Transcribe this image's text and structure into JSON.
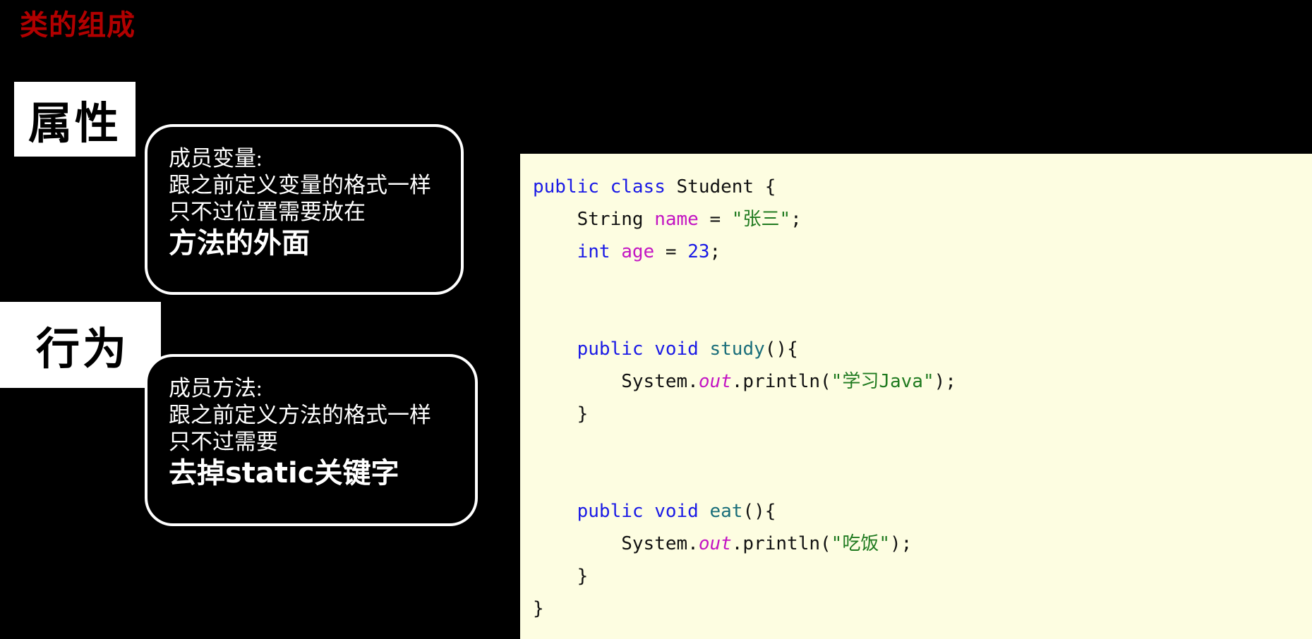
{
  "slide": {
    "title": "类的组成",
    "title_color": "#b10000",
    "background_color": "#000000"
  },
  "labels": [
    {
      "id": "attributes",
      "text": "属性"
    },
    {
      "id": "behaviour",
      "text": "行为"
    }
  ],
  "bubbles": [
    {
      "id": "member-variable",
      "lines": [
        "成员变量:",
        "跟之前定义变量的格式一样",
        "只不过位置需要放在"
      ],
      "emphasis": "方法的外面"
    },
    {
      "id": "member-method",
      "lines": [
        "成员方法:",
        "跟之前定义方法的格式一样",
        "只不过需要"
      ],
      "emphasis": "去掉static关键字"
    }
  ],
  "code_panel": {
    "background_color": "#fdfde1",
    "language": "java",
    "colors": {
      "keyword": "#1a1ae6",
      "identifier": "#c315c3",
      "string": "#1f7a1f",
      "number": "#1a1ae6",
      "method": "#1a6e7a",
      "plain": "#111111"
    },
    "lines": [
      {
        "indent": 0,
        "tokens": [
          {
            "t": "public",
            "c": "kw"
          },
          {
            "t": " ",
            "c": "plain"
          },
          {
            "t": "class",
            "c": "kw"
          },
          {
            "t": " Student {",
            "c": "plain"
          }
        ]
      },
      {
        "indent": 1,
        "tokens": [
          {
            "t": "String",
            "c": "plain"
          },
          {
            "t": " ",
            "c": "plain"
          },
          {
            "t": "name",
            "c": "ident-mag"
          },
          {
            "t": " = ",
            "c": "plain"
          },
          {
            "t": "\"张三\"",
            "c": "str-green"
          },
          {
            "t": ";",
            "c": "plain"
          }
        ]
      },
      {
        "indent": 1,
        "tokens": [
          {
            "t": "int",
            "c": "kw"
          },
          {
            "t": " ",
            "c": "plain"
          },
          {
            "t": "age",
            "c": "ident-mag"
          },
          {
            "t": " = ",
            "c": "plain"
          },
          {
            "t": "23",
            "c": "num-blue"
          },
          {
            "t": ";",
            "c": "plain"
          }
        ]
      },
      {
        "indent": 0,
        "tokens": []
      },
      {
        "indent": 0,
        "tokens": []
      },
      {
        "indent": 1,
        "tokens": [
          {
            "t": "public",
            "c": "kw"
          },
          {
            "t": " ",
            "c": "plain"
          },
          {
            "t": "void",
            "c": "kw"
          },
          {
            "t": " ",
            "c": "plain"
          },
          {
            "t": "study",
            "c": "method-teal"
          },
          {
            "t": "(){",
            "c": "plain"
          }
        ]
      },
      {
        "indent": 2,
        "tokens": [
          {
            "t": "System.",
            "c": "plain"
          },
          {
            "t": "out",
            "c": "ident-mag-i"
          },
          {
            "t": ".println(",
            "c": "plain"
          },
          {
            "t": "\"学习Java\"",
            "c": "str-green"
          },
          {
            "t": ");",
            "c": "plain"
          }
        ]
      },
      {
        "indent": 1,
        "tokens": [
          {
            "t": "}",
            "c": "plain"
          }
        ]
      },
      {
        "indent": 0,
        "tokens": []
      },
      {
        "indent": 0,
        "tokens": []
      },
      {
        "indent": 1,
        "tokens": [
          {
            "t": "public",
            "c": "kw"
          },
          {
            "t": " ",
            "c": "plain"
          },
          {
            "t": "void",
            "c": "kw"
          },
          {
            "t": " ",
            "c": "plain"
          },
          {
            "t": "eat",
            "c": "method-teal"
          },
          {
            "t": "(){",
            "c": "plain"
          }
        ]
      },
      {
        "indent": 2,
        "tokens": [
          {
            "t": "System.",
            "c": "plain"
          },
          {
            "t": "out",
            "c": "ident-mag-i"
          },
          {
            "t": ".println(",
            "c": "plain"
          },
          {
            "t": "\"吃饭\"",
            "c": "str-green"
          },
          {
            "t": ");",
            "c": "plain"
          }
        ]
      },
      {
        "indent": 1,
        "tokens": [
          {
            "t": "}",
            "c": "plain"
          }
        ]
      },
      {
        "indent": 0,
        "tokens": [
          {
            "t": "}",
            "c": "plain"
          }
        ]
      }
    ]
  }
}
